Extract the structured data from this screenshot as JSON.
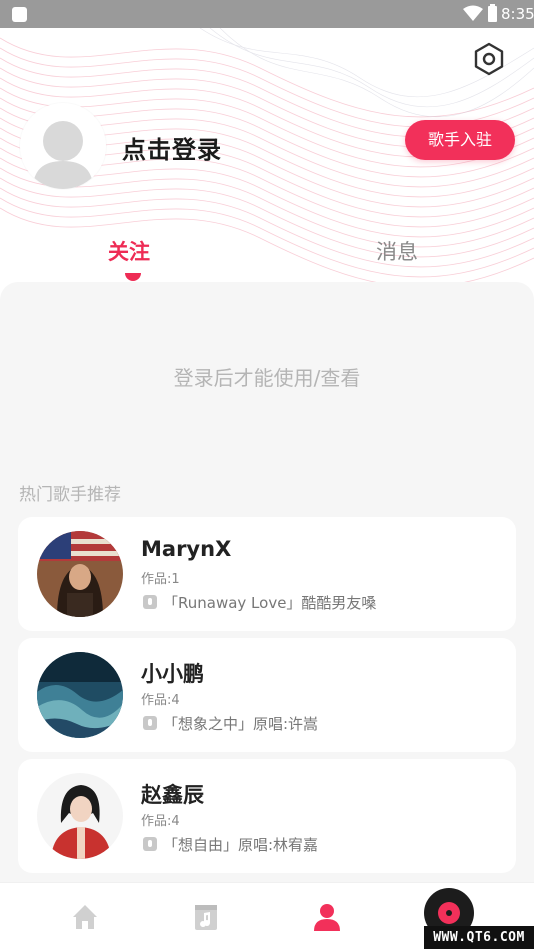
{
  "status_bar": {
    "time": "8:35"
  },
  "header": {
    "login_label": "点击登录",
    "singer_button_label": "歌手入驻",
    "settings_icon": "hexagon-settings-icon"
  },
  "tabs": [
    {
      "label": "关注",
      "active": true
    },
    {
      "label": "消息",
      "active": false
    }
  ],
  "empty_message": "登录后才能使用/查看",
  "recommend": {
    "title": "热门歌手推荐",
    "singers": [
      {
        "name": "MarynX",
        "works": "作品:1",
        "song": "「Runaway Love」酷酷男友嗓"
      },
      {
        "name": "小小鹏",
        "works": "作品:4",
        "song": "「想象之中」原唱:许嵩"
      },
      {
        "name": "赵鑫辰",
        "works": "作品:4",
        "song": "「想自由」原唱:林宥嘉"
      }
    ]
  },
  "bottom_nav": [
    "home-icon",
    "music-book-icon",
    "profile-icon",
    "disc-player-icon"
  ],
  "colors": {
    "accent": "#f2305a",
    "background": "#f6f6f6"
  },
  "watermark": "WWW.QT6.COM"
}
